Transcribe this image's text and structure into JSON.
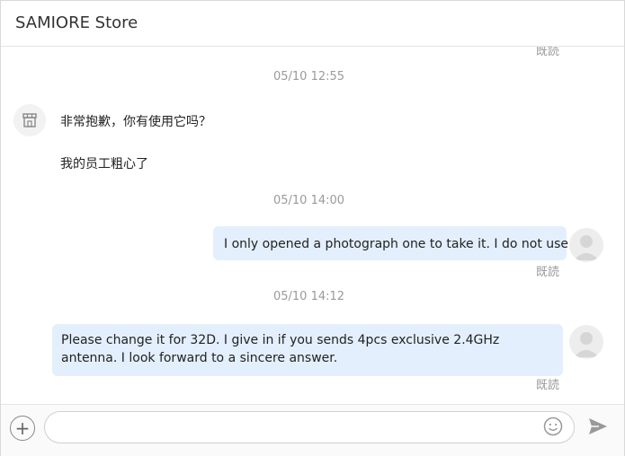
{
  "header": {
    "title": "SAMIORE Store"
  },
  "messages": {
    "read_top": "既読",
    "time1": "05/10 12:55",
    "store_msg1": "非常抱歉，你有使用它吗？",
    "store_msg2": "我的员工粗心了",
    "time2": "05/10 14:00",
    "user_msg1": "I only opened a photograph one to take it. I do not use it .",
    "read1": "既読",
    "time3": "05/10 14:12",
    "user_msg2": "Please change it for 32D. I give in if you sends 4pcs exclusive 2.4GHz antenna. I look forward to a sincere answer.",
    "read2": "既読"
  },
  "composer": {
    "placeholder": ""
  },
  "icons": {
    "store_avatar": "store-icon",
    "user_avatar": "user-avatar-icon",
    "add": "plus-circle-icon",
    "emoji": "smiley-icon",
    "send": "send-icon"
  },
  "colors": {
    "bubble": "#e3effc",
    "muted": "#999999"
  }
}
